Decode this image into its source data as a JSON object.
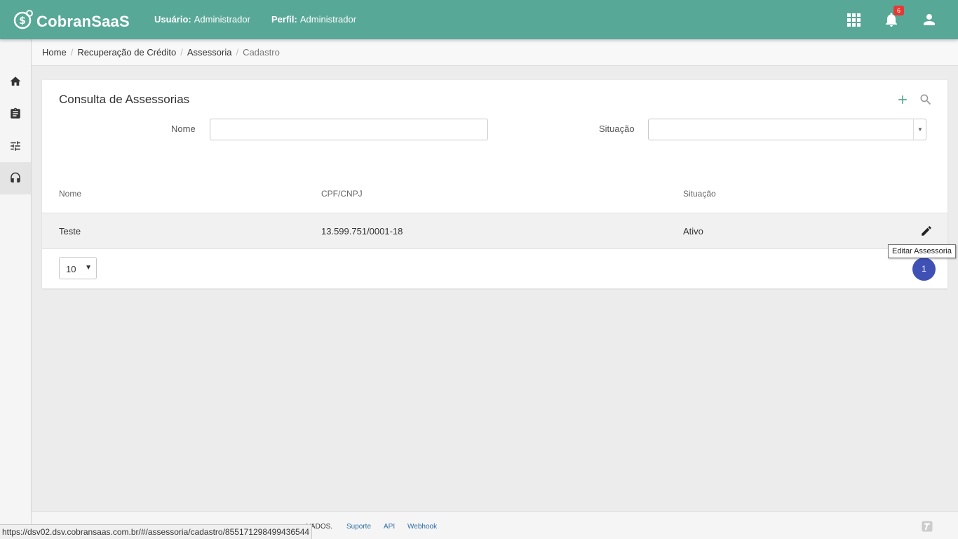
{
  "app": {
    "brand": "CobranSaaS",
    "user_label": "Usuário:",
    "user_value": "Administrador",
    "profile_label": "Perfil:",
    "profile_value": "Administrador",
    "notification_count": "6",
    "icons": [
      "apps-grid-icon",
      "bell-icon",
      "user-icon"
    ],
    "accent_color": "#58a898"
  },
  "sidebar": {
    "items": [
      {
        "icon": "home-icon",
        "active": false
      },
      {
        "icon": "clipboard-icon",
        "active": false
      },
      {
        "icon": "sliders-icon",
        "active": false
      },
      {
        "icon": "headset-icon",
        "active": true
      }
    ]
  },
  "breadcrumb": {
    "items": [
      "Home",
      "Recuperação de Crédito",
      "Assessoria",
      "Cadastro"
    ],
    "separator": "/"
  },
  "main": {
    "title": "Consulta de Assessorias",
    "actions": [
      "plus-icon",
      "search-icon"
    ],
    "filters": {
      "name_label": "Nome",
      "name_value": "",
      "status_label": "Situação",
      "status_value": ""
    },
    "table": {
      "columns": [
        "Nome",
        "CPF/CNPJ",
        "Situação"
      ],
      "rows": [
        {
          "nome": "Teste",
          "cpf_cnpj": "13.599.751/0001-18",
          "situacao": "Ativo"
        }
      ],
      "edit_tooltip": "Editar Assessoria"
    },
    "pagination": {
      "page_size": "10",
      "current_page": "1",
      "page_color": "#3f51b5"
    }
  },
  "footer": {
    "text": "VADOS.",
    "links": [
      "Suporte",
      "API",
      "Webhook"
    ]
  },
  "statusbar": {
    "url": "https://dsv02.dsv.cobransaas.com.br/#/assessoria/cadastro/855171298499436544"
  }
}
